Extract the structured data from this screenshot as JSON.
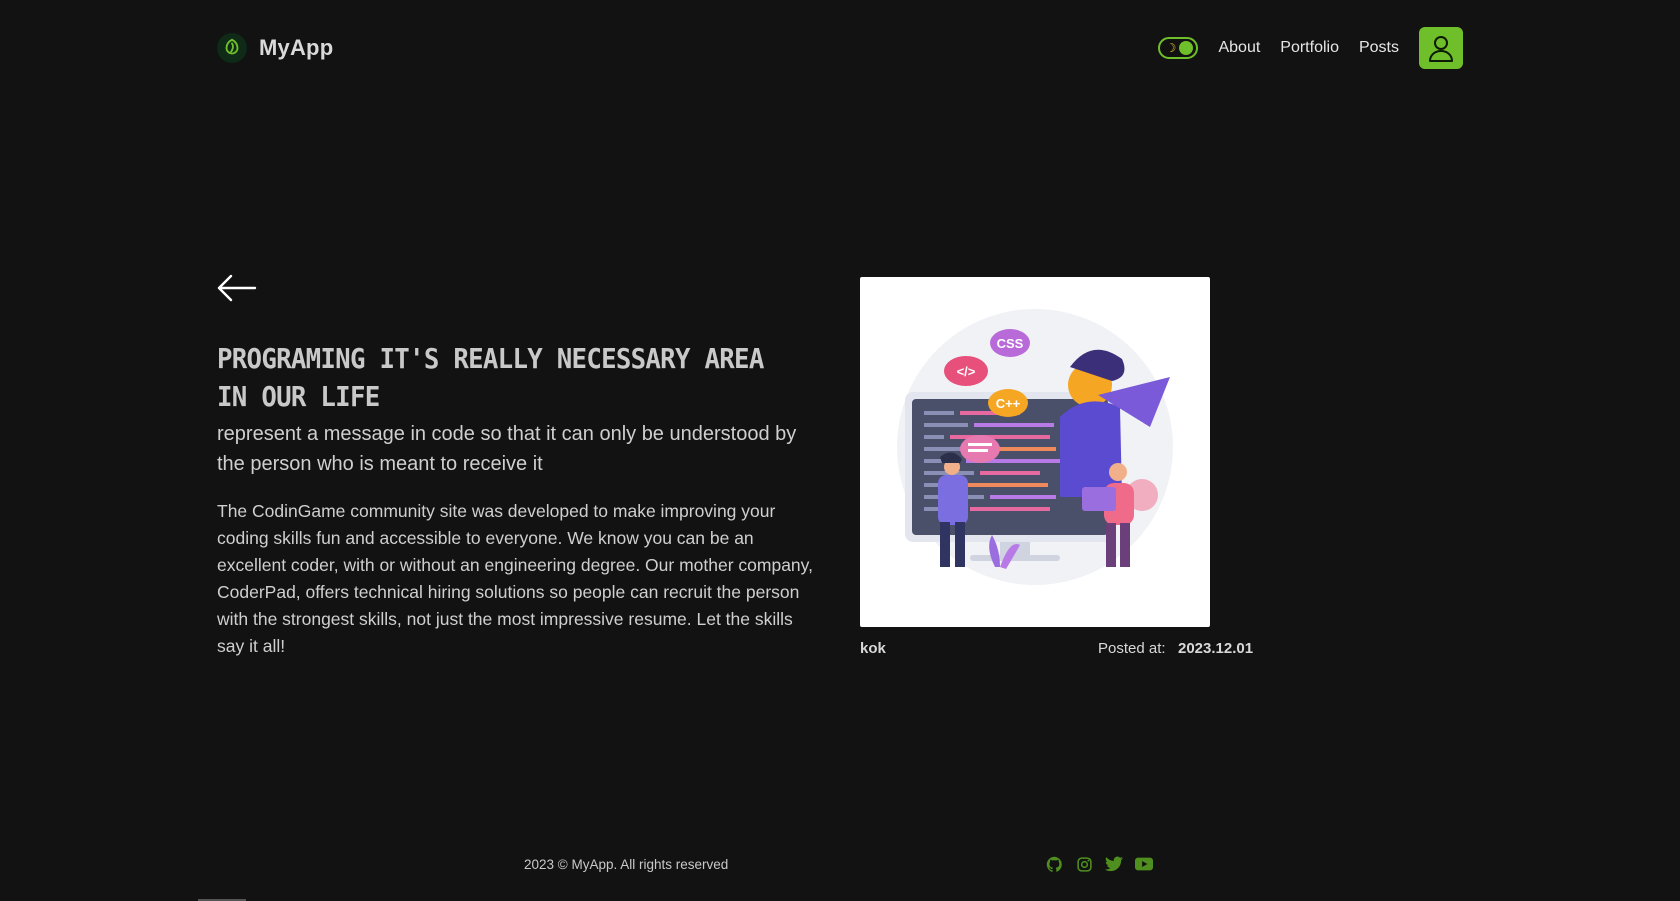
{
  "header": {
    "brand": "MyApp",
    "nav": [
      "About",
      "Portfolio",
      "Posts"
    ],
    "theme_toggle_icon": "moon-icon",
    "user_icon": "user-icon"
  },
  "post": {
    "title": "Programing it's really necessary area in our life",
    "subtitle": "represent a message in code so that it can only be understood by the person who is meant to receive it",
    "body": "The CodinGame community site was developed to make improving your coding skills fun and accessible to everyone. We know you can be an excellent coder, with or without an engineering degree. Our mother company, CoderPad, offers technical hiring solutions so people can recruit the person with the strongest skills, not just the most impressive resume. Let the skills say it all!",
    "author": "kok",
    "posted_label": "Posted at:",
    "posted_date": "2023.12.01",
    "illustration_badges": [
      "CSS",
      "</>",
      "C++"
    ]
  },
  "footer": {
    "copyright": "2023 © MyApp. All rights reserved",
    "socials": [
      "github-icon",
      "instagram-icon",
      "twitter-icon",
      "youtube-icon"
    ]
  },
  "colors": {
    "background": "#121212",
    "accent": "#6fbf2a",
    "text": "#e6e6e6"
  }
}
